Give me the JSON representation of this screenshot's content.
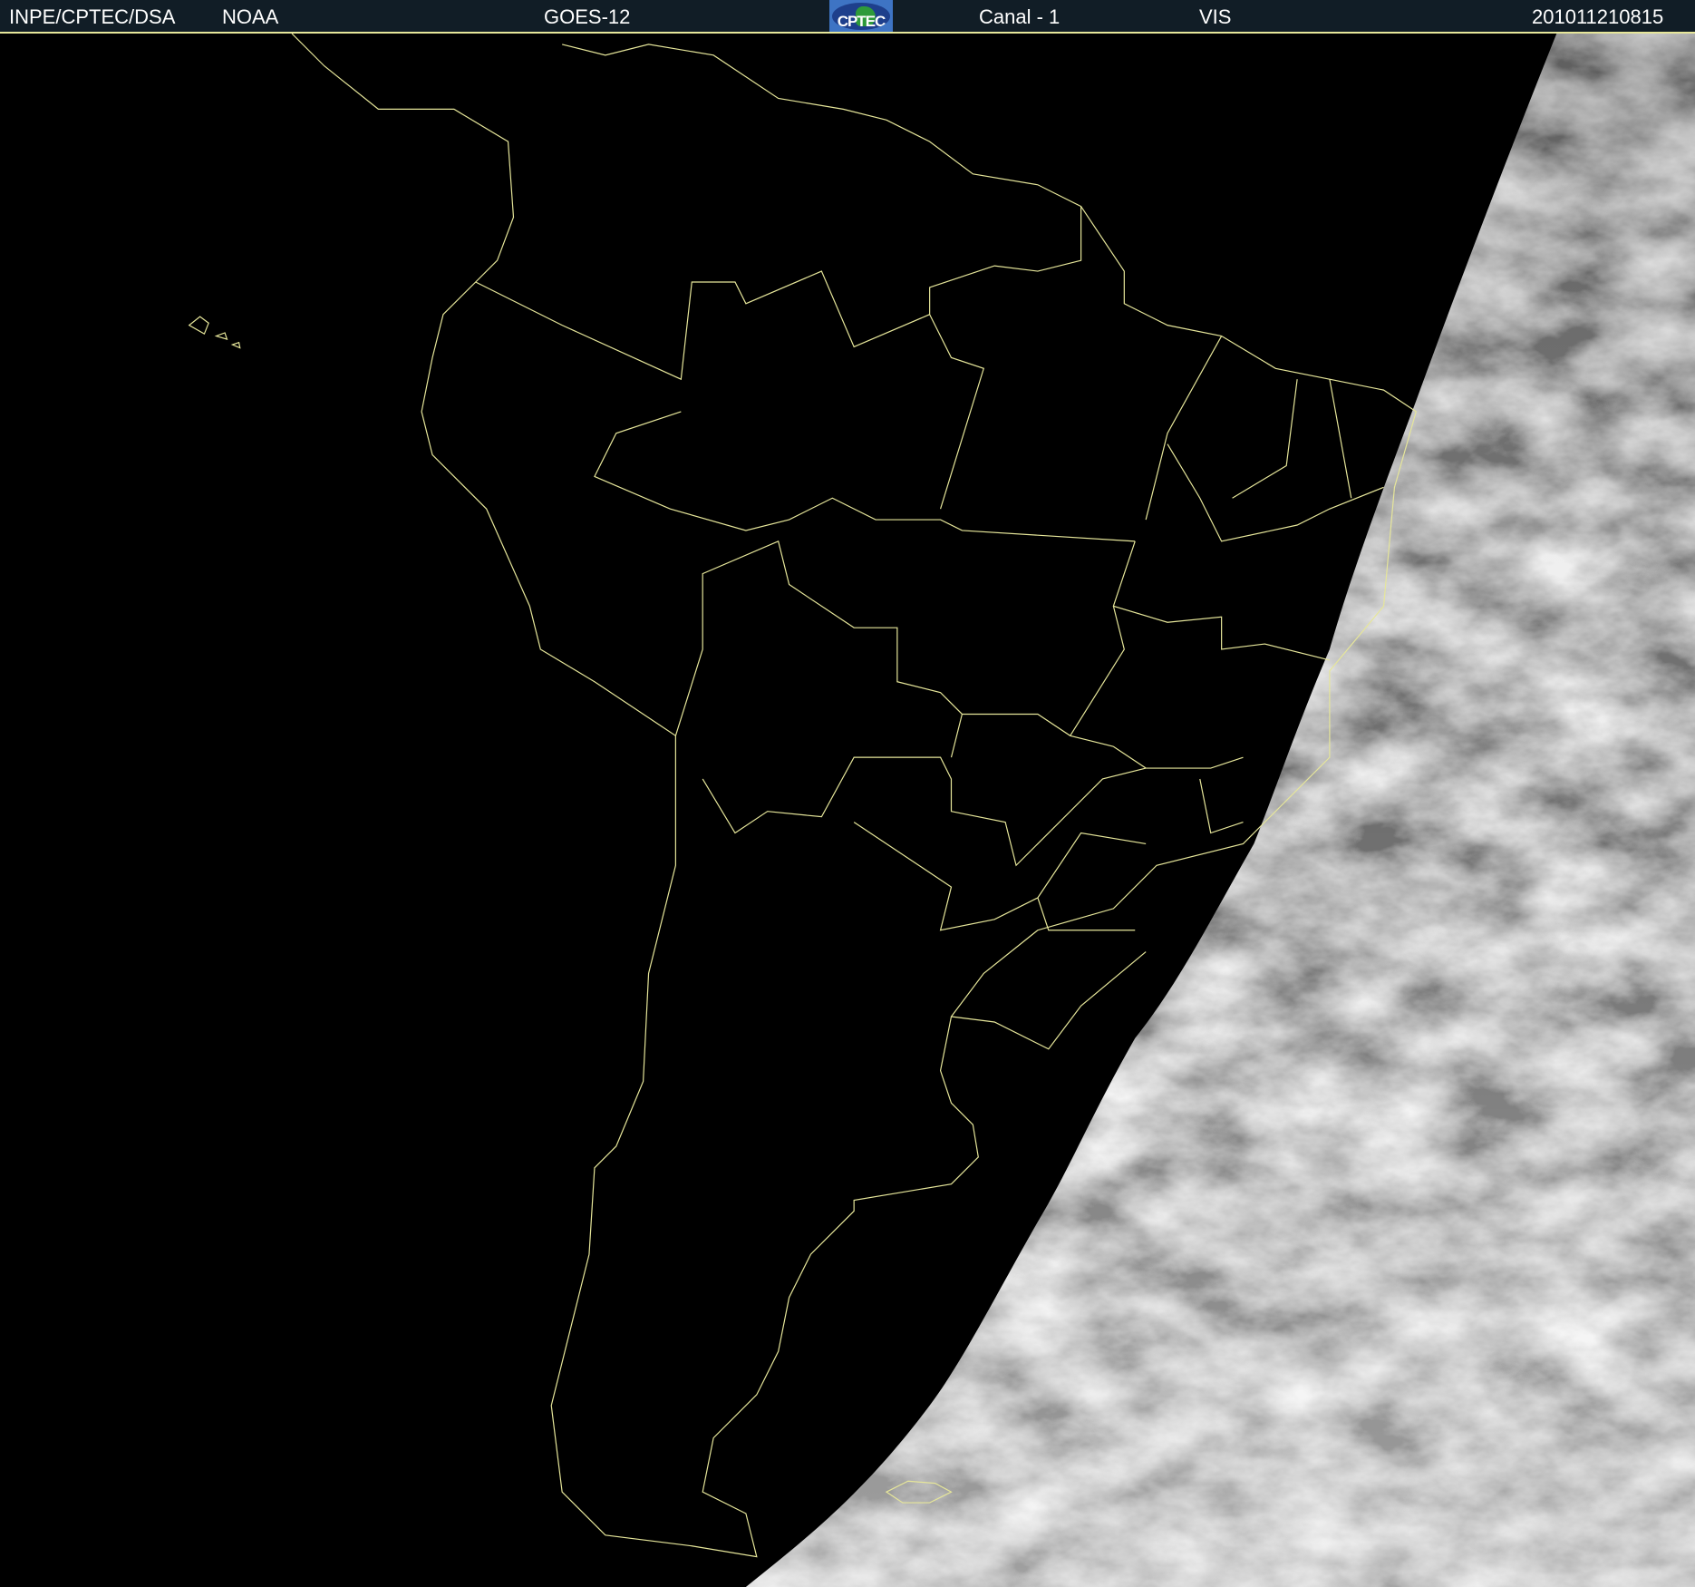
{
  "header": {
    "source": "INPE/CPTEC/DSA",
    "agency": "NOAA",
    "satellite": "GOES-12",
    "logo_text": "CPTEC",
    "channel": "Canal - 1",
    "band": "VIS",
    "timestamp": "201011210815"
  },
  "colors": {
    "header_bg": "#111d26",
    "border_lines": "#e6e69a",
    "space": "#000000"
  }
}
